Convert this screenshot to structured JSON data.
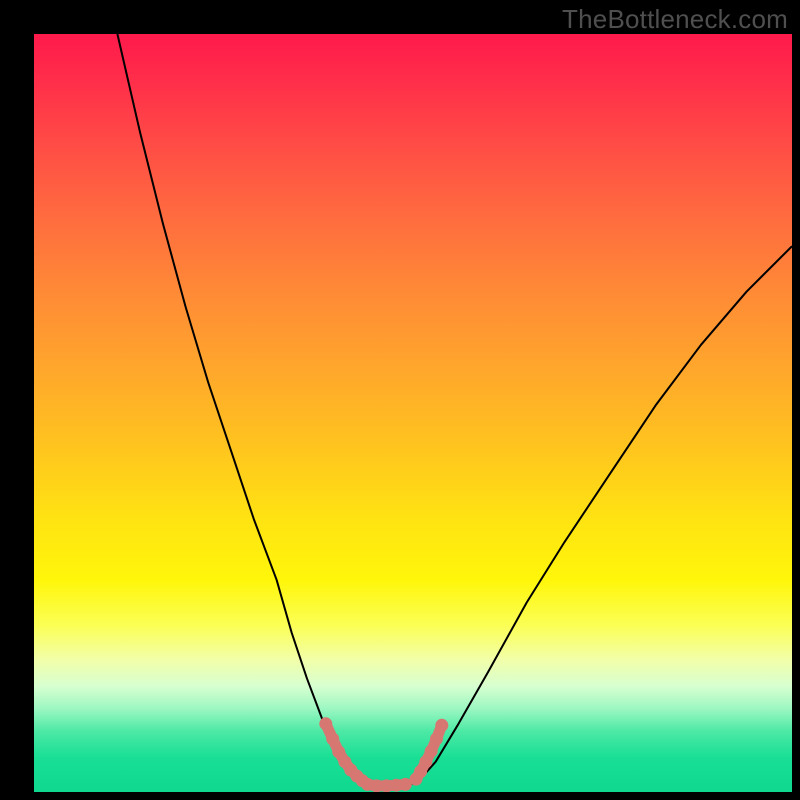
{
  "watermark": "TheBottleneck.com",
  "chart_data": {
    "type": "line",
    "title": "",
    "xlabel": "",
    "ylabel": "",
    "xlim": [
      0,
      100
    ],
    "ylim": [
      0,
      100
    ],
    "series": [
      {
        "name": "left-curve",
        "x": [
          11,
          14,
          17,
          20,
          23,
          26,
          29,
          32,
          34,
          36,
          37.5,
          39,
          40.5,
          42,
          43
        ],
        "values": [
          100,
          87,
          75,
          64,
          54,
          45,
          36,
          28,
          21,
          15,
          11,
          7,
          5,
          3,
          1.5
        ],
        "color": "#000000"
      },
      {
        "name": "flat-minimum",
        "x": [
          43,
          45,
          47,
          49,
          50.5
        ],
        "values": [
          1.5,
          0.8,
          0.8,
          0.9,
          1.2
        ],
        "color": "#000000"
      },
      {
        "name": "right-curve",
        "x": [
          50.5,
          53,
          56,
          60,
          65,
          70,
          76,
          82,
          88,
          94,
          100
        ],
        "values": [
          1.2,
          4,
          9,
          16,
          25,
          33,
          42,
          51,
          59,
          66,
          72
        ],
        "color": "#000000"
      },
      {
        "name": "marker-left",
        "x": [
          38.5,
          39.4,
          40.2,
          41.0,
          41.8,
          42.6,
          43.3
        ],
        "values": [
          9.0,
          7.0,
          5.3,
          4.0,
          2.9,
          2.1,
          1.5
        ],
        "color": "#d77772"
      },
      {
        "name": "marker-bottom",
        "x": [
          44.0,
          45.2,
          46.5,
          47.8,
          49.0
        ],
        "values": [
          1.0,
          0.8,
          0.8,
          0.9,
          1.0
        ],
        "color": "#d77772"
      },
      {
        "name": "marker-right",
        "x": [
          50.4,
          51.0,
          51.7,
          52.4,
          53.1,
          53.8
        ],
        "values": [
          1.7,
          2.7,
          4.0,
          5.4,
          7.0,
          8.8
        ],
        "color": "#d77772"
      }
    ],
    "gradient_stops": [
      {
        "pos": 0.0,
        "color": "#ff1a4b"
      },
      {
        "pos": 0.14,
        "color": "#ff4a46"
      },
      {
        "pos": 0.34,
        "color": "#ff8a36"
      },
      {
        "pos": 0.54,
        "color": "#ffc31f"
      },
      {
        "pos": 0.72,
        "color": "#fff60a"
      },
      {
        "pos": 0.86,
        "color": "#d8ffd0"
      },
      {
        "pos": 0.95,
        "color": "#18df95"
      },
      {
        "pos": 1.0,
        "color": "#0fd98f"
      }
    ]
  }
}
